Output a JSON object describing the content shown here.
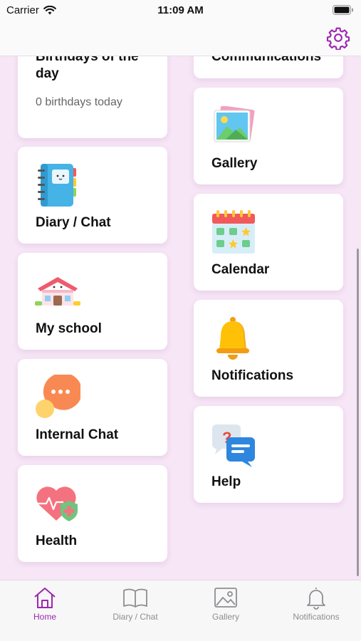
{
  "status_bar": {
    "carrier": "Carrier",
    "time": "11:09 AM"
  },
  "header": {
    "settings_icon": "gear-icon",
    "accent": "#9b27b0"
  },
  "cards": {
    "birthdays": {
      "title_line1": "Birthdays of the",
      "title_line2": "day",
      "subtitle": "0 birthdays today"
    },
    "communications": {
      "title": "Communications"
    },
    "diary": {
      "title": "Diary / Chat",
      "icon": "notebook-icon"
    },
    "gallery": {
      "title": "Gallery",
      "icon": "photos-icon"
    },
    "school": {
      "title": "My school",
      "icon": "school-house-icon"
    },
    "calendar": {
      "title": "Calendar",
      "icon": "calendar-icon"
    },
    "internal_chat": {
      "title": "Internal Chat",
      "icon": "chat-bubbles-icon"
    },
    "notifications": {
      "title": "Notifications",
      "icon": "bell-icon"
    },
    "health": {
      "title": "Health",
      "icon": "heart-shield-icon"
    },
    "help": {
      "title": "Help",
      "icon": "help-chat-icon"
    }
  },
  "tabs": [
    {
      "label": "Home",
      "icon": "home-icon",
      "active": true
    },
    {
      "label": "Diary / Chat",
      "icon": "book-icon",
      "active": false
    },
    {
      "label": "Gallery",
      "icon": "image-icon",
      "active": false
    },
    {
      "label": "Notifications",
      "icon": "bell-outline-icon",
      "active": false
    }
  ]
}
